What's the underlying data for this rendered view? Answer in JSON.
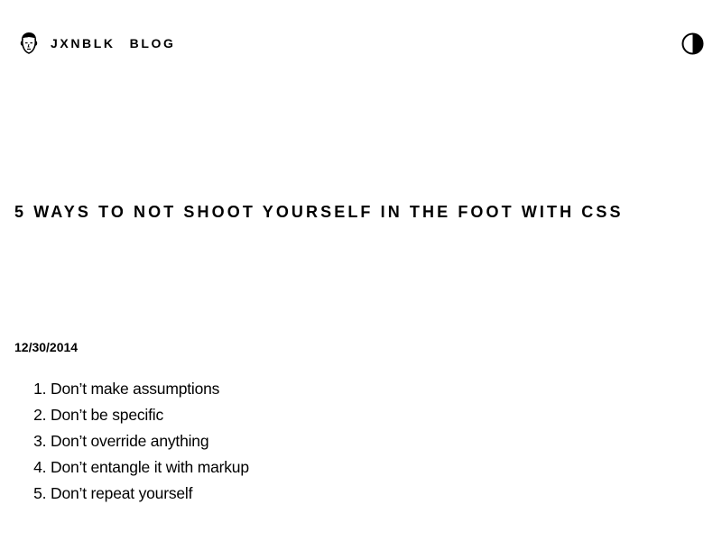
{
  "header": {
    "logo_icon": "avatar-face-icon",
    "nav": [
      {
        "label": "JXNBLK"
      },
      {
        "label": "BLOG"
      }
    ],
    "theme_toggle_icon": "half-circle-contrast-icon"
  },
  "post": {
    "title": "5 WAYS TO NOT SHOOT YOURSELF IN THE FOOT WITH CSS",
    "date": "12/30/2014",
    "items": [
      {
        "number": "1.",
        "text": "Don’t make assumptions"
      },
      {
        "number": "2.",
        "text": "Don’t be specific"
      },
      {
        "number": "3.",
        "text": "Don’t override anything"
      },
      {
        "number": "4.",
        "text": "Don’t entangle it with markup"
      },
      {
        "number": "5.",
        "text": "Don’t repeat yourself"
      }
    ]
  }
}
